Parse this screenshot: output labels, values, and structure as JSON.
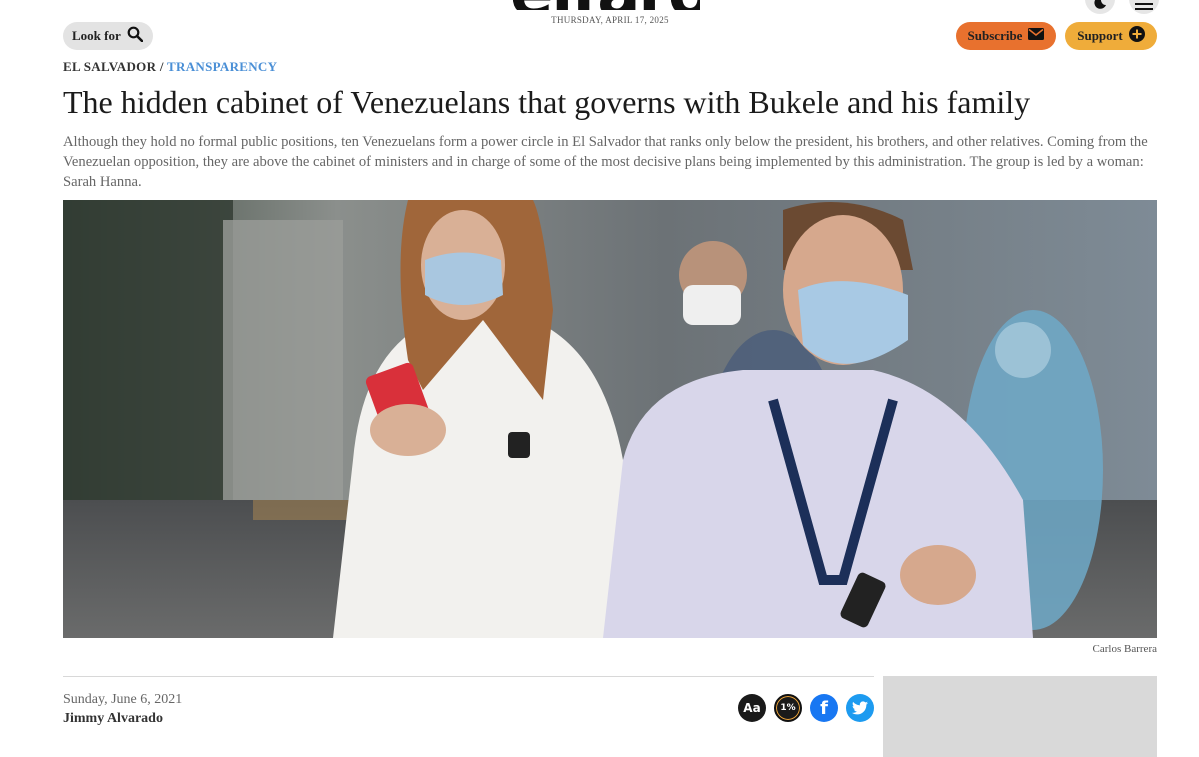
{
  "masthead": {
    "logo": "elfaro",
    "date": "THURSDAY, APRIL 17, 2025",
    "icons": [
      "moon-icon",
      "menu-icon"
    ]
  },
  "search": {
    "label": "Look for",
    "icon": "search-icon"
  },
  "subscribe": {
    "label": "Subscribe",
    "icon": "mail-icon",
    "color": "#e8712e"
  },
  "support": {
    "label": "Support",
    "icon": "plus-icon",
    "color": "#efac3a"
  },
  "breadcrumb": {
    "country": "EL SALVADOR",
    "separator": " / ",
    "section": "TRANSPARENCY",
    "section_color": "#4a8fd6"
  },
  "article": {
    "title": "The hidden cabinet of Venezuelans that governs with Bukele and his family",
    "lede": "Although they hold no formal public positions, ten Venezuelans form a power circle in El Salvador that ranks only below the president, his brothers, and other relatives. Coming from the Venezuelan opposition, they are above the cabinet of ministers and in charge of some of the most decisive plans being implemented by this administration. The group is led by a woman: Sarah Hanna.",
    "photo_credit": "Carlos Barrera",
    "date": "Sunday, June 6, 2021",
    "author": "Jimmy Alvarado"
  },
  "share": {
    "font_size_label": "Aa",
    "percent_label": "1%",
    "facebook_label": "f",
    "icons": [
      "font-size-icon",
      "percent-icon",
      "facebook-icon",
      "twitter-icon"
    ]
  }
}
